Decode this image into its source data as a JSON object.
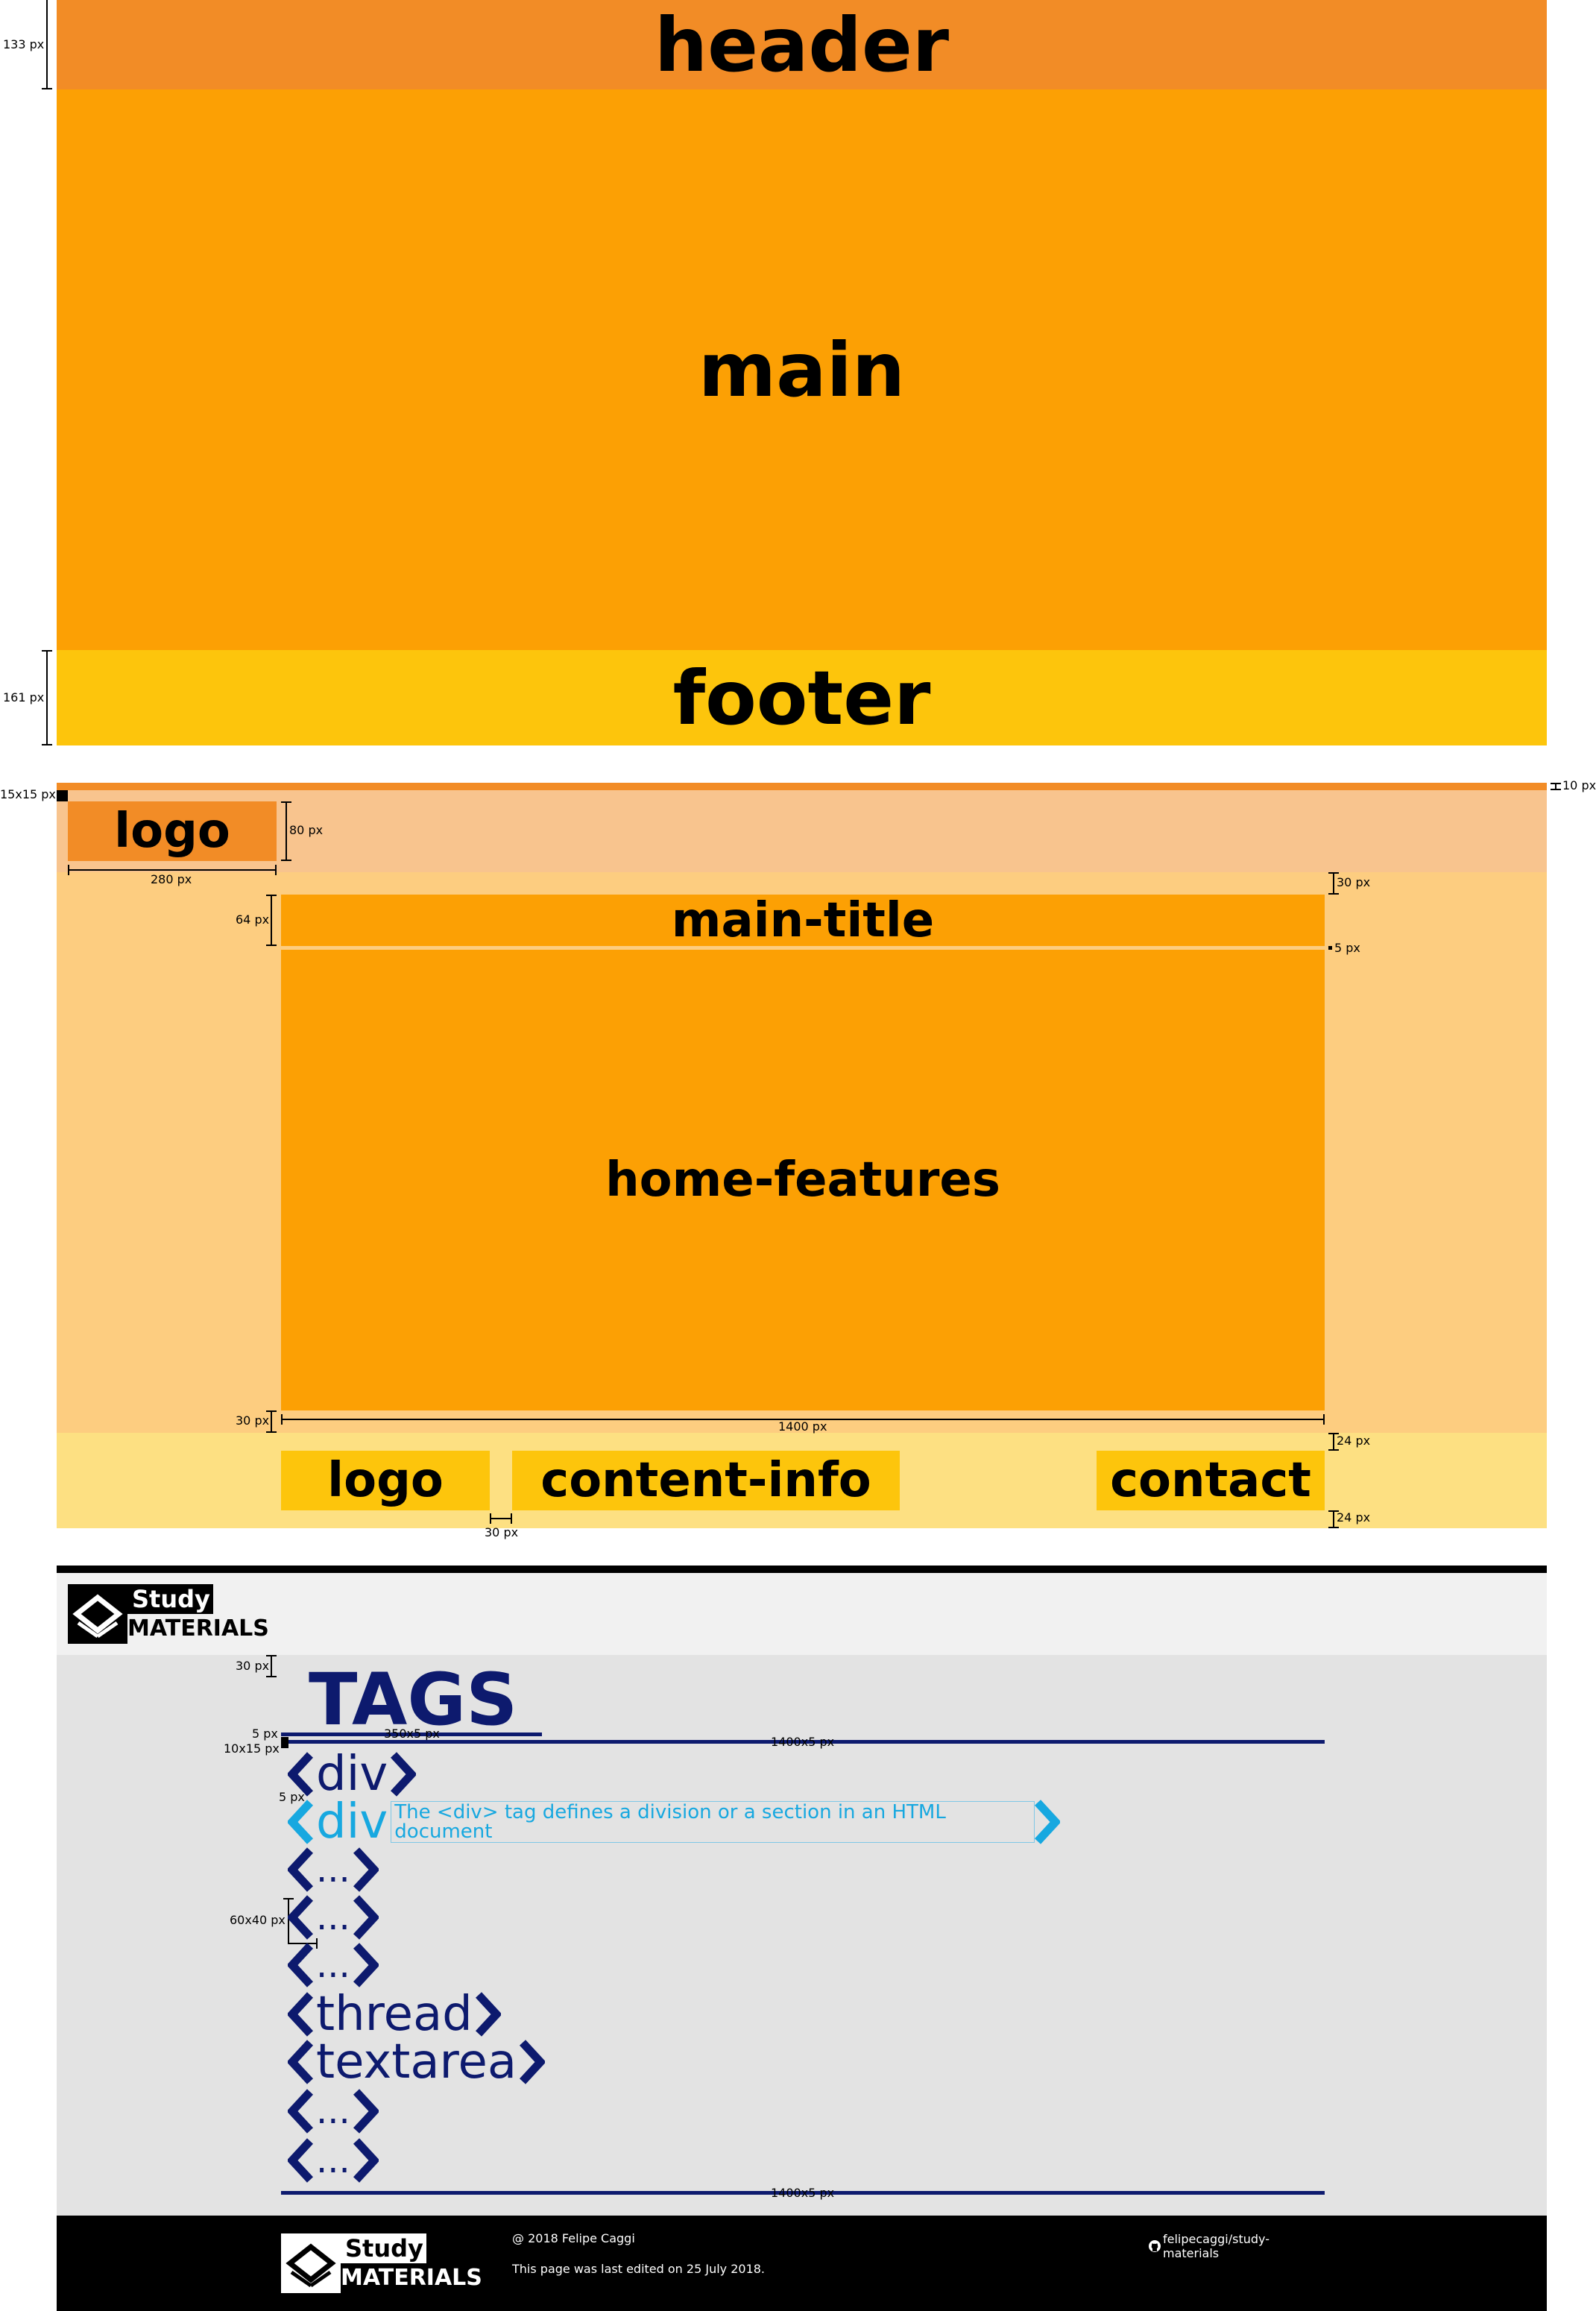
{
  "section1": {
    "header": "header",
    "main": "main",
    "footer": "footer",
    "dim_header": "133 px",
    "dim_footer": "161 px"
  },
  "section2": {
    "logo": "logo",
    "main_title": "main-title",
    "home_features": "home-features",
    "footer_logo": "logo",
    "content_info": "content-info",
    "contact": "contact",
    "dim_15x15": "15x15 px",
    "dim_10": "10 px",
    "dim_80": "80 px",
    "dim_280": "280 px",
    "dim_64": "64 px",
    "dim_30_top": "30 px",
    "dim_5": "5 px",
    "dim_30_left": "30 px",
    "dim_1400": "1400 px",
    "dim_24_top": "24 px",
    "dim_24_bottom": "24 px",
    "dim_30_gap": "30 px"
  },
  "section3": {
    "brand_line1": "Study",
    "brand_line2": "MATERIALS",
    "tags_title": "TAGS",
    "dim_30": "30 px",
    "dim_5": "5 px",
    "dim_10x15": "10x15 px",
    "dim_350x5": "350x5 px",
    "dim_1400x5_top": "1400x5 px",
    "dim_5_b": "5 px",
    "dim_60x40": "60x40 px",
    "dim_1400x5_bottom": "1400x5 px",
    "tags": [
      {
        "name": "div"
      },
      {
        "name": "div",
        "description": "The <div> tag defines a division or a section in an HTML document"
      },
      {
        "name": "..."
      },
      {
        "name": "..."
      },
      {
        "name": "..."
      },
      {
        "name": "thread"
      },
      {
        "name": "textarea"
      },
      {
        "name": "..."
      },
      {
        "name": "..."
      }
    ],
    "footer": {
      "brand_line1": "Study",
      "brand_line2": "MATERIALS",
      "copyright": "@ 2018 Felipe Caggi",
      "edited": "This page was last edited on 25 July 2018.",
      "github": "felipecaggi/study-materials"
    }
  },
  "colors": {
    "header": "#f28c26",
    "main": "#fca004",
    "footer": "#fdc50c",
    "header_light": "#f8c48e",
    "main_light": "#fdcd80",
    "footer_light": "#fde082",
    "navy": "#0d1a6e",
    "cyan": "#17a8e0",
    "light_gray": "#f1f1f1",
    "mid_gray": "#e3e3e3"
  }
}
